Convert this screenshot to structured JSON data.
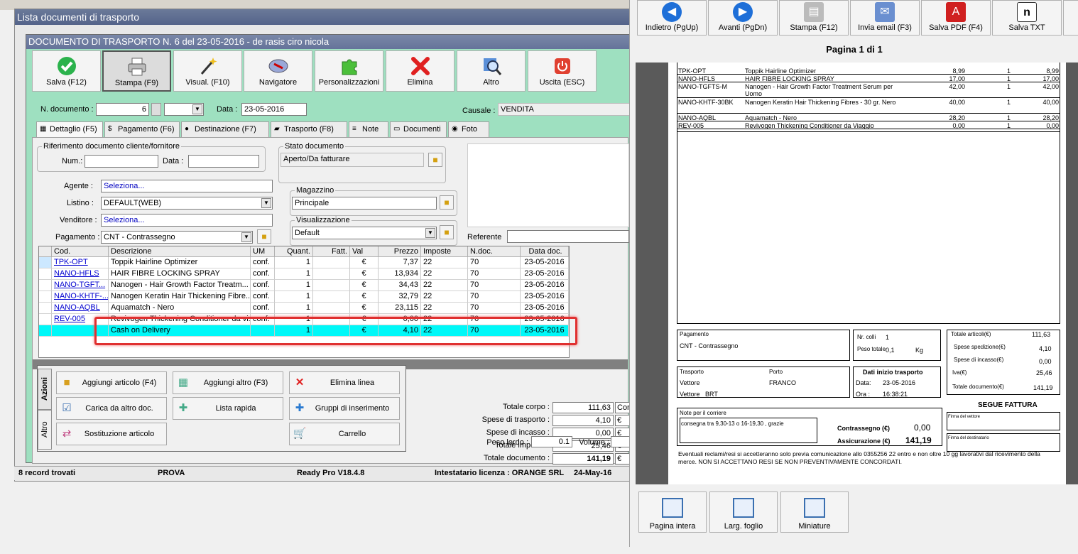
{
  "outer_window": {
    "title": "Lista documenti di trasporto"
  },
  "doc_window": {
    "title": "DOCUMENTO DI TRASPORTO N. 6 del 23-05-2016 - de rasis ciro nicola"
  },
  "toolbar": [
    {
      "label": "Salva (F12)",
      "icon": "check-icon"
    },
    {
      "label": "Stampa (F9)",
      "icon": "printer-icon"
    },
    {
      "label": "Visual. (F10)",
      "icon": "magic-wand-icon"
    },
    {
      "label": "Navigatore",
      "icon": "compass-icon"
    },
    {
      "label": "Personalizzazioni",
      "icon": "puzzle-icon"
    },
    {
      "label": "Elimina",
      "icon": "delete-x-icon"
    },
    {
      "label": "Altro",
      "icon": "magnifier-icon"
    },
    {
      "label": "Uscita (ESC)",
      "icon": "power-icon"
    }
  ],
  "header": {
    "n_doc_label": "N. documento :",
    "n_doc_value": "6",
    "data_label": "Data :",
    "data_value": "23-05-2016",
    "causale_label": "Causale :",
    "causale_value": "VENDITA"
  },
  "tabs": [
    {
      "label": "Dettaglio (F5)",
      "icon": "calendar-icon"
    },
    {
      "label": "Pagamento (F6)",
      "icon": "money-icon"
    },
    {
      "label": "Destinazione (F7)",
      "icon": "globe-icon"
    },
    {
      "label": "Trasporto (F8)",
      "icon": "truck-icon"
    },
    {
      "label": "Note",
      "icon": "note-icon"
    },
    {
      "label": "Documenti",
      "icon": "folder-icon"
    },
    {
      "label": "Foto",
      "icon": "camera-icon"
    }
  ],
  "riferimento": {
    "title": "Riferimento documento cliente/fornitore",
    "num_label": "Num.:",
    "data_label": "Data :"
  },
  "stato": {
    "title": "Stato documento",
    "value": "Aperto/Da fatturare"
  },
  "magazzino": {
    "title": "Magazzino",
    "value": "Principale"
  },
  "visualizzazione": {
    "title": "Visualizzazione",
    "value": "Default"
  },
  "referente_label": "Referente",
  "fields": {
    "agente_label": "Agente :",
    "agente_value": "Seleziona...",
    "listino_label": "Listino :",
    "listino_value": "DEFAULT(WEB)",
    "venditore_label": "Venditore :",
    "venditore_value": "Seleziona...",
    "pagamento_label": "Pagamento :",
    "pagamento_value": "CNT - Contrassegno"
  },
  "grid": {
    "columns": [
      "Cod.",
      "Descrizione",
      "UM",
      "Quant.",
      "Fatt.",
      "Val",
      "Prezzo",
      "Imposte",
      "N.doc.",
      "Data doc."
    ],
    "rows": [
      [
        "TPK-OPT",
        "Toppik Hairline Optimizer",
        "conf.",
        "1",
        "",
        "€",
        "7,37",
        "22",
        "70",
        "23-05-2016"
      ],
      [
        "NANO-HFLS",
        "HAIR FIBRE LOCKING SPRAY",
        "conf.",
        "1",
        "",
        "€",
        "13,934",
        "22",
        "70",
        "23-05-2016"
      ],
      [
        "NANO-TGFT...",
        "Nanogen - Hair Growth Factor Treatm...",
        "conf.",
        "1",
        "",
        "€",
        "34,43",
        "22",
        "70",
        "23-05-2016"
      ],
      [
        "NANO-KHTF-...",
        "Nanogen Keratin Hair Thickening Fibre...",
        "conf.",
        "1",
        "",
        "€",
        "32,79",
        "22",
        "70",
        "23-05-2016"
      ],
      [
        "NANO-AQBL",
        "Aquamatch - Nero",
        "conf.",
        "1",
        "",
        "€",
        "23,115",
        "22",
        "70",
        "23-05-2016"
      ],
      [
        "REV-005",
        "Revivogen Thickening Conditioner da vi...",
        "conf.",
        "1",
        "",
        "€",
        "0,00",
        "22",
        "70",
        "23-05-2016"
      ],
      [
        "",
        "Cash on Delivery",
        "",
        "1",
        "",
        "€",
        "4,10",
        "22",
        "70",
        "23-05-2016"
      ]
    ]
  },
  "actions": {
    "tab_azioni": "Azioni",
    "tab_altro": "Altro",
    "buttons": [
      {
        "label": "Aggiungi articolo (F4)",
        "icon": "box-add-icon"
      },
      {
        "label": "Aggiungi altro (F3)",
        "icon": "grid-add-icon"
      },
      {
        "label": "Elimina linea",
        "icon": "delete-x-icon"
      },
      {
        "label": "Carica da altro doc.",
        "icon": "checklist-icon"
      },
      {
        "label": "Lista rapida",
        "icon": "list-add-icon"
      },
      {
        "label": "Gruppi di inserimento",
        "icon": "group-add-icon"
      },
      {
        "label": "Sostituzione articolo",
        "icon": "swap-icon"
      },
      {
        "label": "Carrello",
        "icon": "cart-icon"
      }
    ]
  },
  "totals": [
    {
      "label": "Totale corpo :",
      "value": "111,63",
      "suffix": "Corri"
    },
    {
      "label": "Spese di trasporto :",
      "value": "4,10",
      "suffix": "€"
    },
    {
      "label": "Spese di incasso :",
      "value": "0,00",
      "suffix": "€"
    },
    {
      "label": "Totale imposte :",
      "value": "25,46",
      "suffix": "€"
    },
    {
      "label": "Totale documento :",
      "value": "141,19",
      "suffix": "€"
    }
  ],
  "peso": {
    "label": "Peso lordo :",
    "value": "0.1",
    "volume_label": "Volume :"
  },
  "status": {
    "records": "8 record trovati",
    "user": "PROVA",
    "version": "Ready Pro V18.4.8",
    "licence": "Intestatario licenza : ORANGE SRL",
    "date": "24-May-16"
  },
  "preview": {
    "buttons": [
      {
        "label": "Indietro (PgUp)",
        "icon": "arrow-left-icon"
      },
      {
        "label": "Avanti (PgDn)",
        "icon": "arrow-right-icon"
      },
      {
        "label": "Stampa (F12)",
        "icon": "printer-icon"
      },
      {
        "label": "Invia email (F3)",
        "icon": "email-icon"
      },
      {
        "label": "Salva PDF (F4)",
        "icon": "pdf-icon"
      },
      {
        "label": "Salva TXT",
        "icon": "txt-icon"
      }
    ],
    "page_label": "Pagina 1 di 1",
    "bottom_buttons": [
      {
        "label": "Pagina intera",
        "icon": "page-full-icon"
      },
      {
        "label": "Larg. foglio",
        "icon": "page-width-icon"
      },
      {
        "label": "Miniature",
        "icon": "thumbnails-icon"
      }
    ],
    "doc_rows": [
      [
        "TPK-OPT",
        "Toppik Hairline Optimizer",
        "8,99",
        "1",
        "8,99"
      ],
      [
        "NANO-HFLS",
        "HAIR FIBRE LOCKING SPRAY",
        "17,00",
        "1",
        "17,00"
      ],
      [
        "NANO-TGFTS-M",
        "Nanogen - Hair Growth Factor Treatment Serum per Uomo",
        "42,00",
        "1",
        "42,00"
      ],
      [
        "NANO-KHTF-30BK",
        "Nanogen Keratin Hair Thickening Fibres - 30 gr. Nero",
        "40,00",
        "1",
        "40,00"
      ],
      [
        "NANO-AQBL",
        "Aquamatch - Nero",
        "28,20",
        "1",
        "28,20"
      ],
      [
        "REV-005",
        "Revivogen Thickening Conditioner da Viaggio",
        "0,00",
        "1",
        "0,00"
      ]
    ],
    "pagamento_title": "Pagamento",
    "pagamento_value": "CNT - Contrassegno",
    "ncolli_label": "Nr. colli",
    "ncolli_value": "1",
    "peso_label": "Peso totale",
    "peso_value": "0,1",
    "peso_unit": "Kg",
    "tot_articoli_label": "Totale articoli(€)",
    "tot_articoli_value": "111,63",
    "spese_sped_label": "Spese spedizione(€)",
    "spese_sped_value": "4,10",
    "spese_incasso_label": "Spese di incasso(€)",
    "spese_incasso_value": "0,00",
    "iva_label": "Iva(€)",
    "iva_value": "25,46",
    "tot_doc_label": "Totale documento(€)",
    "tot_doc_value": "141,19",
    "trasporto_label": "Trasporto",
    "porto_label": "Porto",
    "vettore_label": "Vettore",
    "porto_value": "FRANCO",
    "vettore2_label": "Vettore",
    "vettore2_value": "BRT",
    "inizio_title": "Dati inizio trasporto",
    "inizio_data_label": "Data:",
    "inizio_data_value": "23-05-2016",
    "inizio_ora_label": "Ora :",
    "inizio_ora_value": "16:38:21",
    "segue": "SEGUE FATTURA",
    "note_title": "Note per il corriere",
    "note_value": "consegna tra 9,30-13 o 16-19,30 , grazie",
    "contrassegno_label": "Contrassegno (€)",
    "contrassegno_value": "0,00",
    "assicurazione_label": "Assicurazione (€)",
    "assicurazione_value": "141,19",
    "firma_vettore": "Firma del vettore",
    "firma_destinatario": "Firma del destinatario",
    "footer_note": "Eventuali reclami/resi si accetteranno solo previa comunicazione allo 0355256 22 entro e non oltre 10 gg lavorativi dal ricevimento della merce. NON SI ACCETTANO RESI SE NON PREVENTIVAMENTE CONCORDATI."
  }
}
